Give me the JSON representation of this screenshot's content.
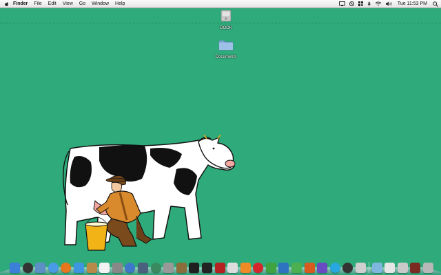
{
  "menubar": {
    "app_name": "Finder",
    "items": [
      "File",
      "Edit",
      "View",
      "Go",
      "Window",
      "Help"
    ],
    "clock": "Tue 11:53 PM"
  },
  "desktop": {
    "icons": [
      {
        "label": "DOOK",
        "icon": "hard-drive-icon"
      },
      {
        "label": "Documents",
        "icon": "folder-icon"
      }
    ]
  },
  "dock": {
    "apps": [
      {
        "name": "finder",
        "color": "#3b7fd8"
      },
      {
        "name": "dashboard",
        "color": "#333333"
      },
      {
        "name": "preview",
        "color": "#5d8fc7"
      },
      {
        "name": "safari",
        "color": "#4a9be6"
      },
      {
        "name": "firefox",
        "color": "#e8761c"
      },
      {
        "name": "ichat",
        "color": "#3e95e0"
      },
      {
        "name": "address-book",
        "color": "#b88a4a"
      },
      {
        "name": "ical",
        "color": "#f2f2f2"
      },
      {
        "name": "system-preferences",
        "color": "#888888"
      },
      {
        "name": "itunes",
        "color": "#3c77c9"
      },
      {
        "name": "spaces",
        "color": "#4b5f7f"
      },
      {
        "name": "time-machine",
        "color": "#3a8a60"
      },
      {
        "name": "bootcamp",
        "color": "#999999"
      },
      {
        "name": "gimp",
        "color": "#8a6d3b"
      },
      {
        "name": "activity-monitor",
        "color": "#1f1f1f"
      },
      {
        "name": "terminal",
        "color": "#222222"
      },
      {
        "name": "photo-booth",
        "color": "#b52020"
      },
      {
        "name": "transmission",
        "color": "#dddddd"
      },
      {
        "name": "vlc",
        "color": "#f08a24"
      },
      {
        "name": "lastfm",
        "color": "#d6262a"
      },
      {
        "name": "excel",
        "color": "#3fa33f"
      },
      {
        "name": "word",
        "color": "#2e73c2"
      },
      {
        "name": "numbers",
        "color": "#4caf50"
      },
      {
        "name": "powerpoint",
        "color": "#d95a1f"
      },
      {
        "name": "keynote",
        "color": "#6a4cc2"
      },
      {
        "name": "skype",
        "color": "#27a8e0"
      },
      {
        "name": "steam",
        "color": "#333333"
      },
      {
        "name": "file-server",
        "color": "#cfcfcf"
      }
    ],
    "stacks": [
      {
        "name": "applications-folder",
        "color": "#7fb6e0"
      },
      {
        "name": "documents-stack",
        "color": "#e6e6e6"
      },
      {
        "name": "mail-stack",
        "color": "#c9c9c9"
      },
      {
        "name": "downloads-stack",
        "color": "#7a2a20"
      },
      {
        "name": "trash",
        "color": "#b8b8b8"
      }
    ]
  }
}
